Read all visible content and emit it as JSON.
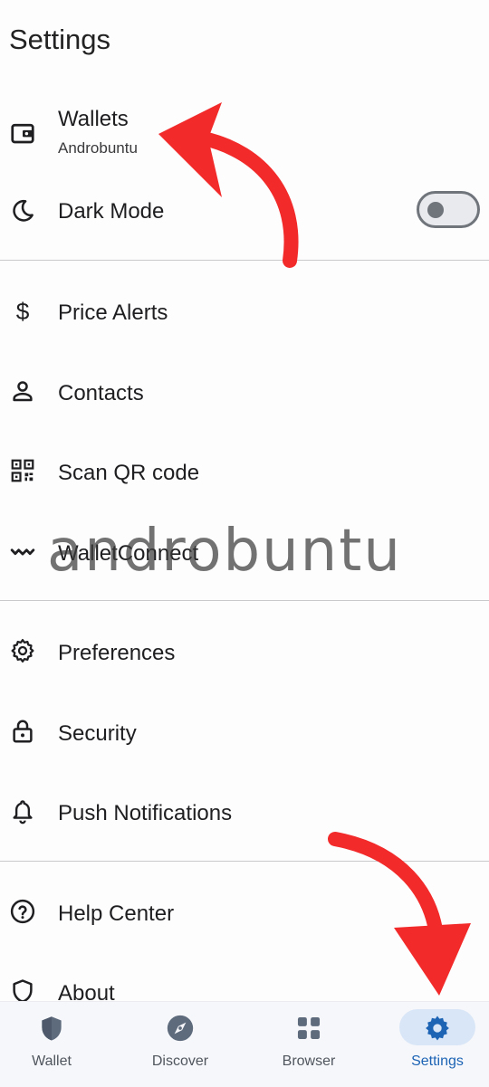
{
  "page": {
    "title": "Settings"
  },
  "wallets": {
    "label": "Wallets",
    "subtitle": "Androbuntu"
  },
  "dark_mode": {
    "label": "Dark Mode",
    "enabled": false
  },
  "menu": {
    "price_alerts": "Price Alerts",
    "contacts": "Contacts",
    "scan_qr": "Scan QR code",
    "walletconnect": "WalletConnect",
    "preferences": "Preferences",
    "security": "Security",
    "push_notifications": "Push Notifications",
    "help_center": "Help Center",
    "about": "About"
  },
  "watermark": "androbuntu",
  "bottom_nav": {
    "wallet": "Wallet",
    "discover": "Discover",
    "browser": "Browser",
    "settings": "Settings",
    "active": "settings"
  },
  "colors": {
    "accent": "#1d64b5",
    "nav_active_bg": "#d9e6f7",
    "icon": "#1f1f22",
    "nav_icon": "#5e6b7d",
    "annotation_arrow": "#f22a2a"
  }
}
